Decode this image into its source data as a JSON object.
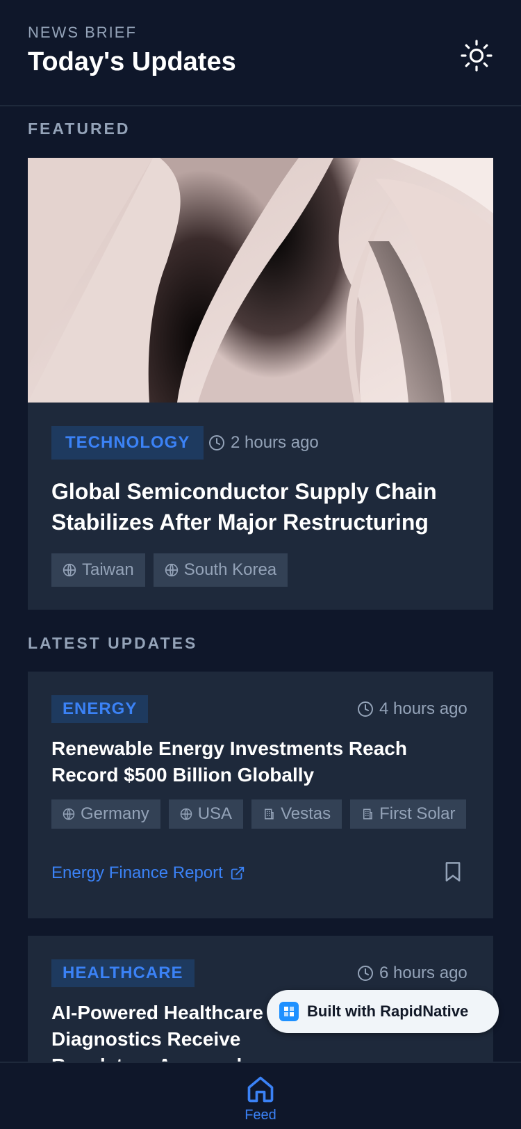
{
  "header": {
    "eyebrow": "NEWS BRIEF",
    "title": "Today's Updates",
    "theme_icon": "sun-icon"
  },
  "featured": {
    "section_label": "FEATURED",
    "category": "TECHNOLOGY",
    "time": "2 hours ago",
    "title": "Global Semiconductor Supply Chain Stabilizes After Major Restructuring",
    "tags": [
      {
        "label": "Taiwan",
        "icon": "globe-icon"
      },
      {
        "label": "South Korea",
        "icon": "globe-icon"
      }
    ]
  },
  "latest": {
    "section_label": "LATEST UPDATES",
    "articles": [
      {
        "category": "ENERGY",
        "time": "4 hours ago",
        "title": "Renewable Energy Investments Reach Record $500 Billion Globally",
        "tags": [
          {
            "label": "Germany",
            "icon": "globe-icon"
          },
          {
            "label": "USA",
            "icon": "globe-icon"
          },
          {
            "label": "Vestas",
            "icon": "building-icon"
          },
          {
            "label": "First Solar",
            "icon": "building-icon"
          }
        ],
        "source": "Energy Finance Report"
      },
      {
        "category": "HEALTHCARE",
        "time": "6 hours ago",
        "title": "AI-Powered Healthcare Diagnostics Receive Regulatory Approval"
      }
    ]
  },
  "built_badge": {
    "label": "Built with RapidNative"
  },
  "tabbar": {
    "feed_label": "Feed"
  },
  "colors": {
    "background": "#0f172a",
    "card": "#1e293b",
    "accent": "#3b82f6",
    "muted": "#94a3b8",
    "badge_bg": "#1e3a5f",
    "chip_bg": "#334155"
  }
}
